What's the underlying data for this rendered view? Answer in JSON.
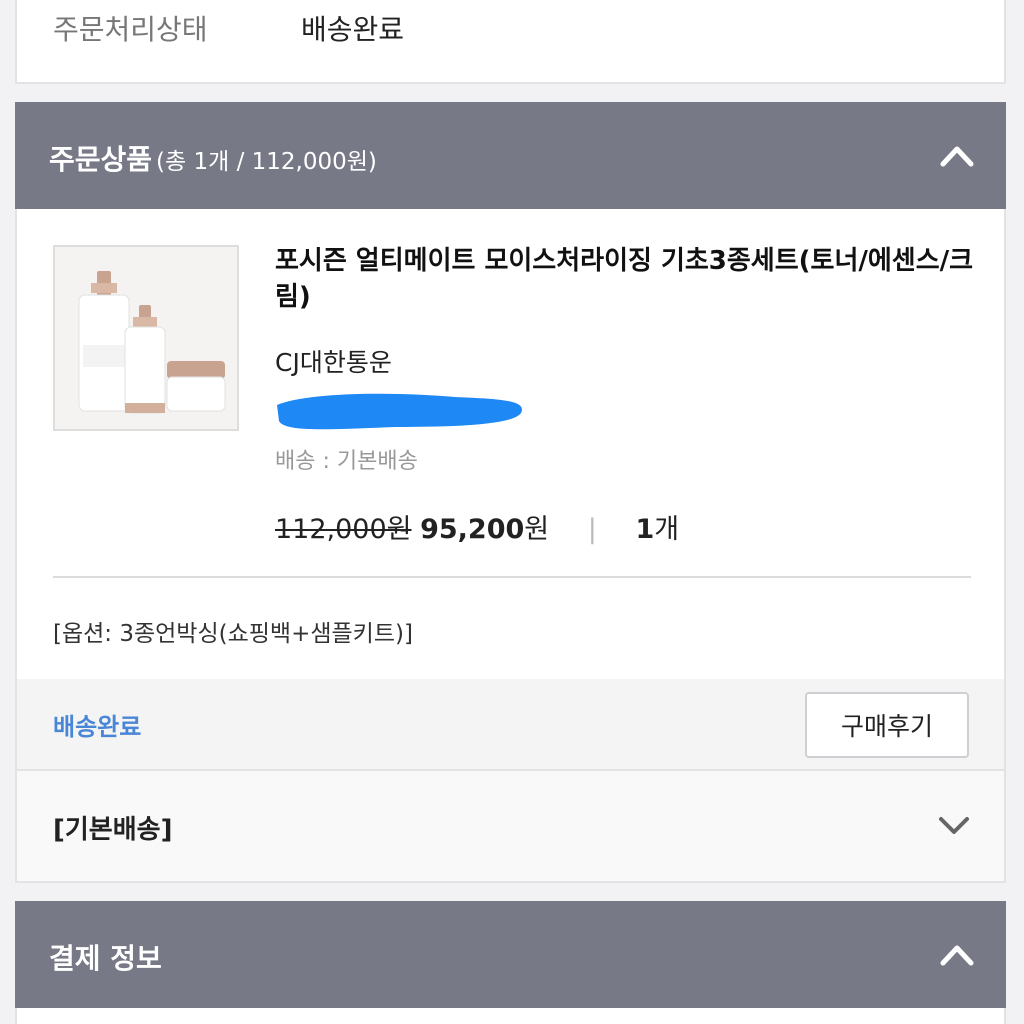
{
  "status_card": {
    "label": "주문처리상태",
    "value": "배송완료"
  },
  "order_section": {
    "title": "주문상품",
    "summary": "(총 1개 / 112,000원)"
  },
  "product": {
    "title": "포시즌 얼티메이트 모이스처라이징 기초3종세트(토너/에센스/크림)",
    "carrier": "CJ대한통운",
    "shipping": "배송 : 기본배송",
    "original_price": "112,000원",
    "sale_price": "95,200",
    "sale_unit": "원",
    "separator": "|",
    "qty_number": "1",
    "qty_unit": "개",
    "option": "[옵션: 3종언박싱(쇼핑백+샘플키트)]",
    "status": "배송완료",
    "review_button": "구매후기",
    "basic_shipping": "[기본배송]"
  },
  "payment_section": {
    "title": "결제 정보"
  },
  "colors": {
    "section_header_bg": "#777987",
    "status_blue": "#4a86d6",
    "redaction_blue": "#1e88f5"
  }
}
